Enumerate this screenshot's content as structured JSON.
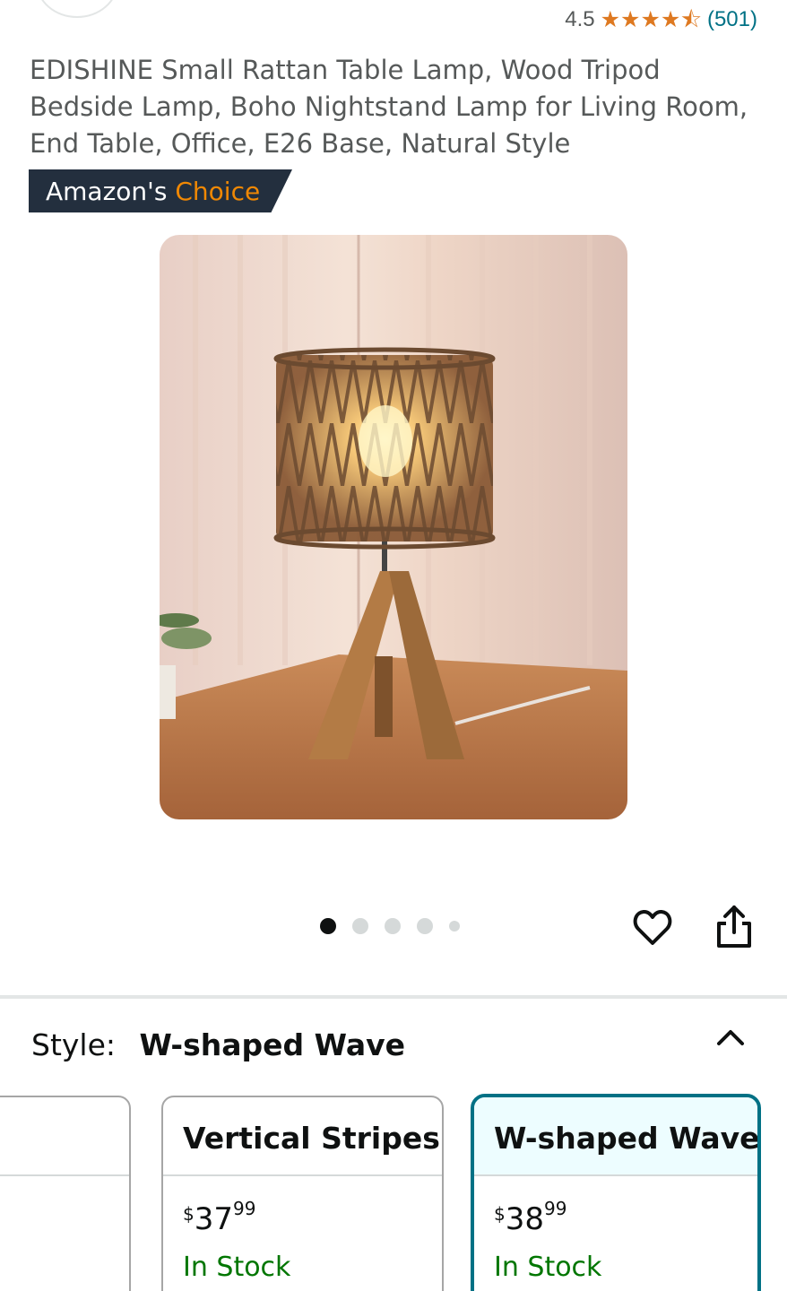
{
  "rating": {
    "value": "4.5",
    "stars": 4.5,
    "count": "(501)",
    "star_color": "#de7921"
  },
  "product": {
    "title": "EDISHINE Small Rattan Table Lamp, Wood Tripod Bedside Lamp, Boho Nightstand Lamp for Living Room, End Table, Office, E26 Base, Natural Style"
  },
  "badge": {
    "prefix": "Amazon's",
    "accent": "Choice",
    "bg_color": "#232f3e",
    "accent_color": "#f08804"
  },
  "gallery": {
    "image_count": 5,
    "active_index": 0
  },
  "actions": {
    "wishlist_icon": "heart-icon",
    "share_icon": "share-icon"
  },
  "variation": {
    "label": "Style:",
    "selected_value": "W-shaped Wave",
    "toggle_icon": "chevron-up-icon",
    "options": [
      {
        "name": "",
        "price_dollars": "",
        "price_cents": "",
        "stock": ""
      },
      {
        "name": "Vertical Stripes",
        "price_dollars": "$37",
        "price_cents": "99",
        "stock": "In Stock"
      },
      {
        "name": "W-shaped Wave",
        "price_dollars": "$38",
        "price_cents": "99",
        "stock": "In Stock",
        "selected": true
      }
    ],
    "selected_border_color": "#007185",
    "stock_color": "#007600"
  }
}
